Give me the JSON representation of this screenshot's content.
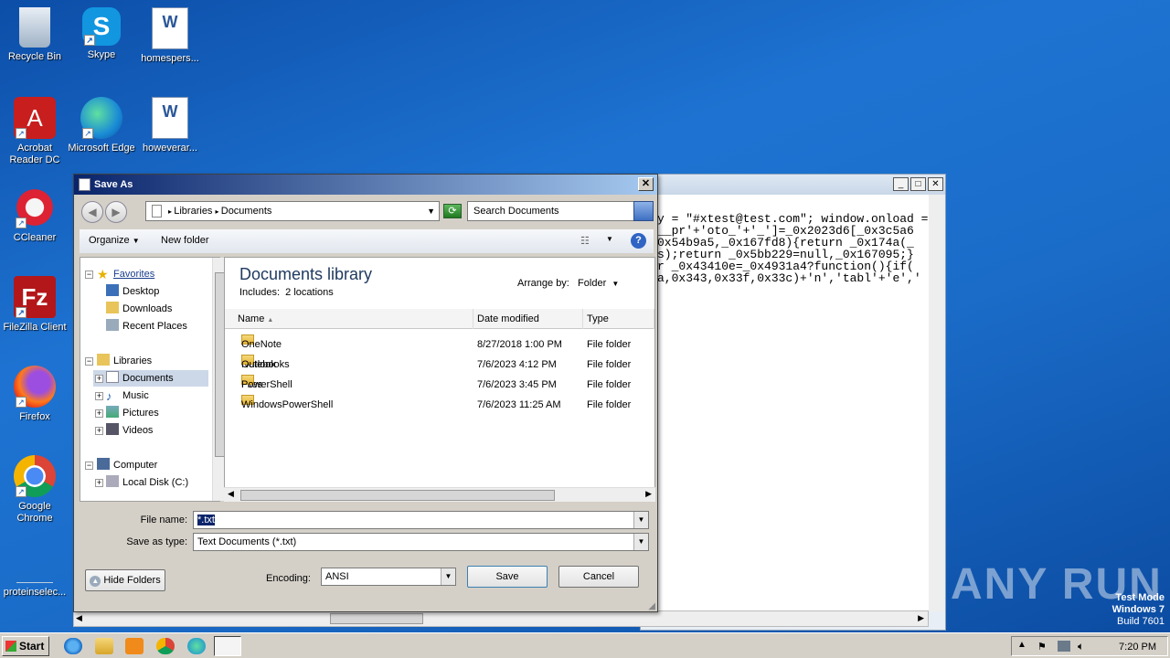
{
  "desktop": {
    "icons": [
      {
        "label": "Recycle Bin",
        "icon": "recycle-bin-icon"
      },
      {
        "label": "Skype",
        "icon": "skype-icon"
      },
      {
        "label": "homespers...",
        "icon": "word-document-icon"
      },
      {
        "label": "Acrobat Reader DC",
        "icon": "acrobat-icon"
      },
      {
        "label": "Microsoft Edge",
        "icon": "edge-icon"
      },
      {
        "label": "howeverar...",
        "icon": "word-document-icon"
      },
      {
        "label": "CCleaner",
        "icon": "ccleaner-icon"
      },
      {
        "label": "FileZilla Client",
        "icon": "filezilla-icon"
      },
      {
        "label": "Firefox",
        "icon": "firefox-icon"
      },
      {
        "label": "Google Chrome",
        "icon": "chrome-icon"
      },
      {
        "label": "proteinselec...",
        "icon": "file-icon"
      }
    ]
  },
  "notepad": {
    "lines": [
      "y = \"#xtest@test.com\"; window.onload =",
      "__pr'+'oto_'+'_']=_0x2023d6[_0x3c5a6",
      "0x54b9a5,_0x167fd8){return _0x174a(_",
      "s);return _0x5bb229=null,_0x167095;}",
      "r _0x43410e=_0x4931a4?function(){if(",
      "a,0x343,0x33f,0x33c)+'n','tabl'+'e','"
    ]
  },
  "dialog": {
    "title": "Save As",
    "breadcrumb": [
      "Libraries",
      "Documents"
    ],
    "search_placeholder": "Search Documents",
    "toolbar": {
      "organize": "Organize",
      "new_folder": "New folder"
    },
    "nav": {
      "favorites": "Favorites",
      "favorites_items": [
        "Desktop",
        "Downloads",
        "Recent Places"
      ],
      "libraries": "Libraries",
      "libraries_items": [
        "Documents",
        "Music",
        "Pictures",
        "Videos"
      ],
      "computer": "Computer",
      "computer_items": [
        "Local Disk (C:)"
      ]
    },
    "library_title": "Documents library",
    "library_includes_label": "Includes:",
    "library_includes_link": "2 locations",
    "arrange_label": "Arrange by:",
    "arrange_value": "Folder",
    "columns": {
      "name": "Name",
      "date": "Date modified",
      "type": "Type"
    },
    "files": [
      {
        "name": "OneNote Notebooks",
        "date": "8/27/2018 1:00 PM",
        "type": "File folder"
      },
      {
        "name": "Outlook Files",
        "date": "7/6/2023 4:12 PM",
        "type": "File folder"
      },
      {
        "name": "PowerShell",
        "date": "7/6/2023 3:45 PM",
        "type": "File folder"
      },
      {
        "name": "WindowsPowerShell",
        "date": "7/6/2023 11:25 AM",
        "type": "File folder"
      }
    ],
    "file_name_label": "File name:",
    "file_name_value": "*.txt",
    "save_type_label": "Save as type:",
    "save_type_value": "Text Documents (*.txt)",
    "hide_folders": "Hide Folders",
    "encoding_label": "Encoding:",
    "encoding_value": "ANSI",
    "save_button": "Save",
    "cancel_button": "Cancel"
  },
  "taskbar": {
    "start": "Start",
    "clock": "7:20 PM"
  },
  "watermark": {
    "line1": "Test Mode",
    "line2": "Windows 7",
    "line3": "Build 7601",
    "brand": "ANY RUN"
  }
}
